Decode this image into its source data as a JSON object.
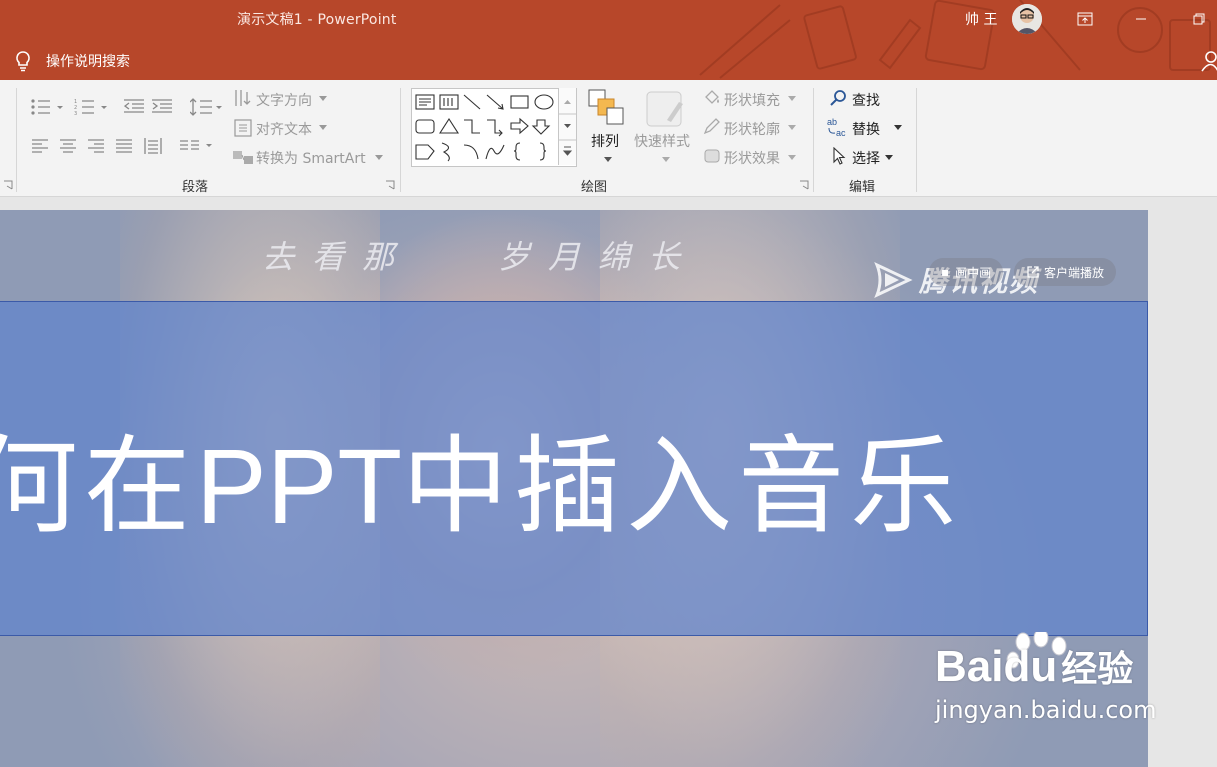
{
  "window": {
    "title": "演示文稿1  -  PowerPoint",
    "user": "帅 王",
    "colors": {
      "titlebar": "#b7472a",
      "ribbon": "#f3f3f3",
      "accent_blue": "#2b5797"
    }
  },
  "tellme": {
    "label": "操作说明搜索"
  },
  "ribbon": {
    "paragraph": {
      "label": "段落",
      "text_direction": "文字方向",
      "align_text": "对齐文本",
      "convert_smartart": "转换为 SmartArt"
    },
    "drawing": {
      "label": "绘图",
      "arrange": "排列",
      "quick_styles": "快速样式",
      "shape_fill": "形状填充",
      "shape_outline": "形状轮廓",
      "shape_effects": "形状效果"
    },
    "editing": {
      "label": "编辑",
      "find": "查找",
      "replace": "替换",
      "select": "选择"
    }
  },
  "slide": {
    "poem_left": "去看那",
    "poem_right": "岁月绵长",
    "video_brand": "腾讯视频",
    "pip_label": "画中画",
    "client_play_label": "客户端播放",
    "title_a": "何在",
    "title_b": "PPT",
    "title_c": "中插入音乐"
  },
  "watermark": {
    "brand": "Bai",
    "brand_du": "du",
    "cn": "经验",
    "url": "jingyan.baidu.com"
  }
}
